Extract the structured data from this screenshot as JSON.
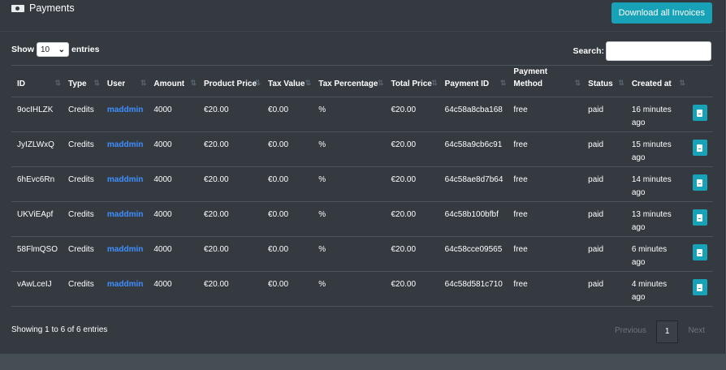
{
  "header": {
    "title": "Payments",
    "download_label": "Download all Invoices",
    "icon": "money-bill-icon"
  },
  "controls": {
    "show_label": "Show",
    "entries_value": "10",
    "entries_label": "entries",
    "search_label": "Search:",
    "search_value": ""
  },
  "columns": [
    "ID",
    "Type",
    "User",
    "Amount",
    "Product Price",
    "Tax Value",
    "Tax Percentage",
    "Total Price",
    "Payment ID",
    "Payment Method",
    "Status",
    "Created at",
    ""
  ],
  "rows": [
    {
      "id": "9ocIHLZK",
      "type": "Credits",
      "user": "maddmin",
      "amount": "4000",
      "product_price": "€20.00",
      "tax_value": "€0.00",
      "tax_percentage": "%",
      "total_price": "€20.00",
      "payment_id": "64c58a8cba168",
      "method": "free",
      "status": "paid",
      "created": "16 minutes ago"
    },
    {
      "id": "JyIZLWxQ",
      "type": "Credits",
      "user": "maddmin",
      "amount": "4000",
      "product_price": "€20.00",
      "tax_value": "€0.00",
      "tax_percentage": "%",
      "total_price": "€20.00",
      "payment_id": "64c58a9cb6c91",
      "method": "free",
      "status": "paid",
      "created": "15 minutes ago"
    },
    {
      "id": "6hEvc6Rn",
      "type": "Credits",
      "user": "maddmin",
      "amount": "4000",
      "product_price": "€20.00",
      "tax_value": "€0.00",
      "tax_percentage": "%",
      "total_price": "€20.00",
      "payment_id": "64c58ae8d7b64",
      "method": "free",
      "status": "paid",
      "created": "14 minutes ago"
    },
    {
      "id": "UKViEApf",
      "type": "Credits",
      "user": "maddmin",
      "amount": "4000",
      "product_price": "€20.00",
      "tax_value": "€0.00",
      "tax_percentage": "%",
      "total_price": "€20.00",
      "payment_id": "64c58b100bfbf",
      "method": "free",
      "status": "paid",
      "created": "13 minutes ago"
    },
    {
      "id": "58FlmQSO",
      "type": "Credits",
      "user": "maddmin",
      "amount": "4000",
      "product_price": "€20.00",
      "tax_value": "€0.00",
      "tax_percentage": "%",
      "total_price": "€20.00",
      "payment_id": "64c58cce09565",
      "method": "free",
      "status": "paid",
      "created": "6 minutes ago"
    },
    {
      "id": "vAwLceIJ",
      "type": "Credits",
      "user": "maddmin",
      "amount": "4000",
      "product_price": "€20.00",
      "tax_value": "€0.00",
      "tax_percentage": "%",
      "total_price": "€20.00",
      "payment_id": "64c58d581c710",
      "method": "free",
      "status": "paid",
      "created": "4 minutes ago"
    }
  ],
  "footer": {
    "info": "Showing 1 to 6 of 6 entries",
    "previous": "Previous",
    "page": "1",
    "next": "Next"
  },
  "colors": {
    "accent": "#17a2b8",
    "link": "#3f8fff",
    "card_bg": "#343a40",
    "page_bg": "#454d55"
  }
}
